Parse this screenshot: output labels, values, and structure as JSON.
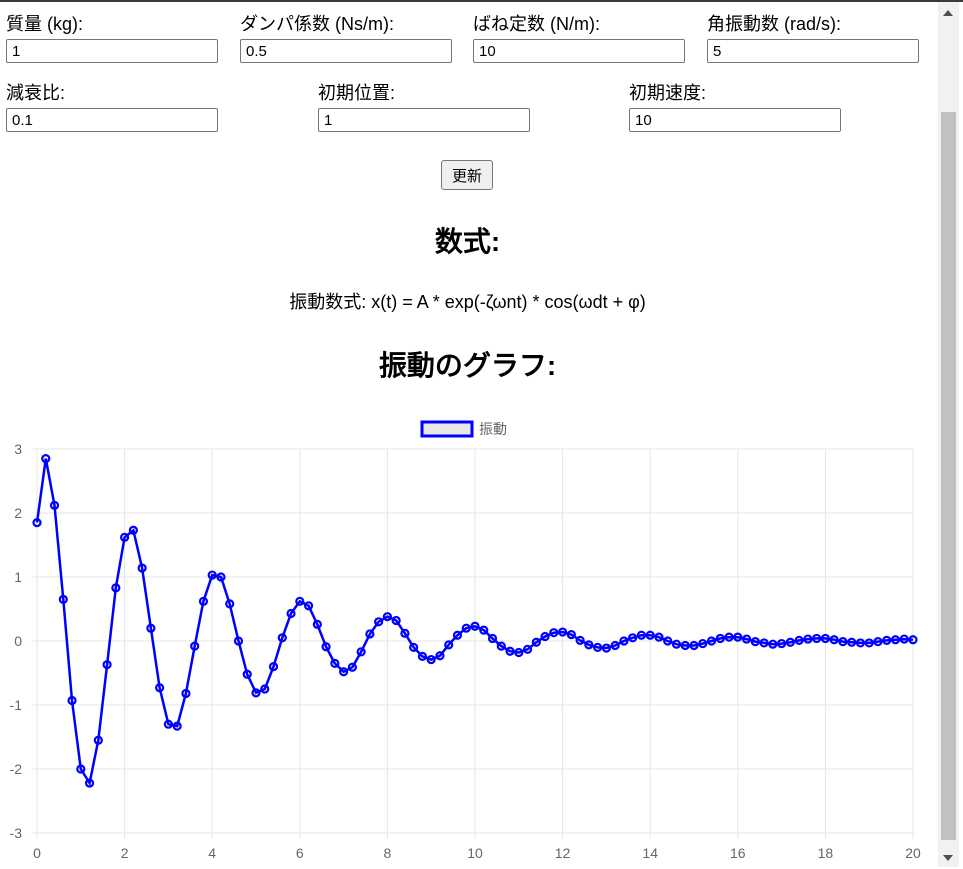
{
  "form": {
    "fields": [
      {
        "label": "質量 (kg):",
        "value": "1"
      },
      {
        "label": "ダンパ係数 (Ns/m):",
        "value": "0.5"
      },
      {
        "label": "ばね定数 (N/m):",
        "value": "10"
      },
      {
        "label": "角振動数 (rad/s):",
        "value": "5"
      },
      {
        "label": "減衰比:",
        "value": "0.1"
      },
      {
        "label": "初期位置:",
        "value": "1"
      },
      {
        "label": "初期速度:",
        "value": "10"
      }
    ],
    "update_label": "更新"
  },
  "formula_section": {
    "heading": "数式:",
    "text": "振動数式: x(t) = A * exp(-ζωnt) * cos(ωdt + φ)"
  },
  "graph_section": {
    "heading": "振動のグラフ:"
  },
  "colors": {
    "series": "#0000ff",
    "legend_fill": "#e8e8e8",
    "grid": "#e6e6e6",
    "tick_text": "#666666"
  },
  "chart_data": {
    "type": "line",
    "x": [
      0.0,
      0.2,
      0.4,
      0.6,
      0.8,
      1.0,
      1.2,
      1.4,
      1.6,
      1.8,
      2.0,
      2.2,
      2.4,
      2.6,
      2.8,
      3.0,
      3.2,
      3.4,
      3.6,
      3.8,
      4.0,
      4.2,
      4.4,
      4.6,
      4.8,
      5.0,
      5.2,
      5.4,
      5.6,
      5.8,
      6.0,
      6.2,
      6.4,
      6.6,
      6.8,
      7.0,
      7.2,
      7.4,
      7.6,
      7.8,
      8.0,
      8.2,
      8.4,
      8.6,
      8.8,
      9.0,
      9.2,
      9.4,
      9.6,
      9.8,
      10.0,
      10.2,
      10.4,
      10.6,
      10.8,
      11.0,
      11.2,
      11.4,
      11.6,
      11.8,
      12.0,
      12.2,
      12.4,
      12.6,
      12.8,
      13.0,
      13.2,
      13.4,
      13.6,
      13.8,
      14.0,
      14.2,
      14.4,
      14.6,
      14.8,
      15.0,
      15.2,
      15.4,
      15.6,
      15.8,
      16.0,
      16.2,
      16.4,
      16.6,
      16.8,
      17.0,
      17.2,
      17.4,
      17.6,
      17.8,
      18.0,
      18.2,
      18.4,
      18.6,
      18.8,
      19.0,
      19.2,
      19.4,
      19.6,
      19.8,
      20.0
    ],
    "series": [
      {
        "name": "振動",
        "values": [
          1.85,
          2.85,
          2.12,
          0.65,
          -0.93,
          -2.0,
          -2.22,
          -1.55,
          -0.37,
          0.83,
          1.62,
          1.73,
          1.14,
          0.2,
          -0.73,
          -1.3,
          -1.33,
          -0.82,
          -0.08,
          0.62,
          1.03,
          1.0,
          0.58,
          0.0,
          -0.52,
          -0.81,
          -0.75,
          -0.4,
          0.05,
          0.43,
          0.62,
          0.55,
          0.26,
          -0.09,
          -0.35,
          -0.48,
          -0.41,
          -0.17,
          0.11,
          0.3,
          0.38,
          0.32,
          0.12,
          -0.1,
          -0.24,
          -0.29,
          -0.23,
          -0.06,
          0.09,
          0.2,
          0.23,
          0.17,
          0.04,
          -0.08,
          -0.16,
          -0.18,
          -0.13,
          -0.02,
          0.07,
          0.13,
          0.14,
          0.1,
          0.01,
          -0.06,
          -0.1,
          -0.11,
          -0.07,
          0.0,
          0.05,
          0.09,
          0.09,
          0.06,
          0.0,
          -0.05,
          -0.07,
          -0.07,
          -0.04,
          0.0,
          0.04,
          0.06,
          0.06,
          0.03,
          -0.01,
          -0.03,
          -0.05,
          -0.04,
          -0.02,
          0.01,
          0.03,
          0.04,
          0.04,
          0.02,
          -0.01,
          -0.02,
          -0.03,
          -0.03,
          -0.01,
          0.01,
          0.02,
          0.03,
          0.02
        ]
      }
    ],
    "xlim": [
      0,
      20
    ],
    "ylim": [
      -3,
      3
    ],
    "xticks": [
      "0",
      "2",
      "4",
      "6",
      "8",
      "10",
      "12",
      "14",
      "16",
      "18",
      "20"
    ],
    "yticks": [
      "3",
      "2",
      "1",
      "0",
      "-1",
      "-2",
      "-3"
    ],
    "grid": true,
    "legend": "top-center"
  }
}
